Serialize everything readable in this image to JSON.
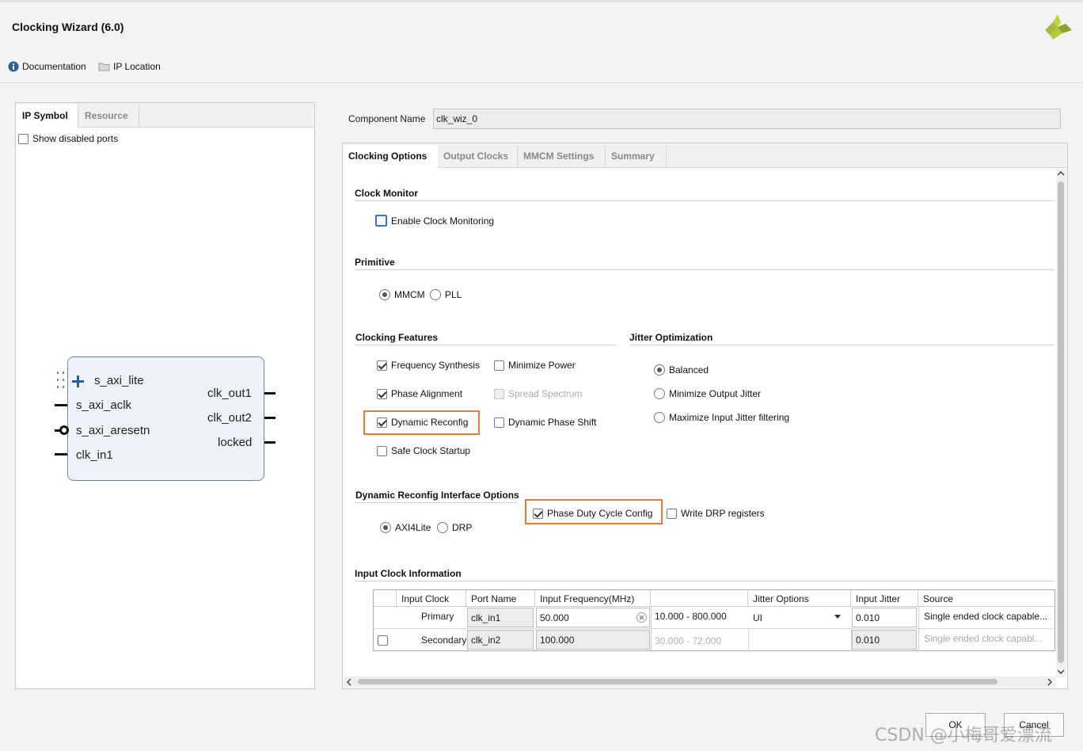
{
  "window": {
    "title": "Clocking Wizard (6.0)"
  },
  "header_links": {
    "documentation": "Documentation",
    "ip_location": "IP Location"
  },
  "left_panel": {
    "tabs": [
      "IP Symbol",
      "Resource"
    ],
    "show_disabled_ports": "Show disabled ports",
    "symbol": {
      "inputs": [
        "s_axi_lite",
        "s_axi_aclk",
        "s_axi_aresetn",
        "clk_in1"
      ],
      "outputs": [
        "clk_out1",
        "clk_out2",
        "locked"
      ]
    }
  },
  "component": {
    "label": "Component Name",
    "value": "clk_wiz_0"
  },
  "tabs": [
    "Clocking Options",
    "Output Clocks",
    "MMCM Settings",
    "Summary"
  ],
  "clock_monitor": {
    "title": "Clock Monitor",
    "enable": "Enable Clock Monitoring"
  },
  "primitive": {
    "title": "Primitive",
    "mmcm": "MMCM",
    "pll": "PLL"
  },
  "clocking_features": {
    "title": "Clocking Features",
    "frequency_synthesis": "Frequency Synthesis",
    "minimize_power": "Minimize Power",
    "phase_alignment": "Phase Alignment",
    "spread_spectrum": "Spread Spectrum",
    "dynamic_reconfig": "Dynamic Reconfig",
    "dynamic_phase_shift": "Dynamic Phase Shift",
    "safe_clock_startup": "Safe Clock Startup"
  },
  "jitter_optimization": {
    "title": "Jitter Optimization",
    "balanced": "Balanced",
    "minimize_output_jitter": "Minimize Output Jitter",
    "maximize_input_jitter": "Maximize Input Jitter filtering"
  },
  "drp_options": {
    "title": "Dynamic Reconfig Interface Options",
    "axi4lite": "AXI4Lite",
    "drp": "DRP",
    "phase_duty": "Phase Duty Cycle Config",
    "write_drp": "Write DRP registers"
  },
  "input_clock": {
    "title": "Input Clock Information",
    "headers": [
      "Input Clock",
      "Port Name",
      "Input Frequency(MHz)",
      "",
      "Jitter Options",
      "Input Jitter",
      "Source"
    ],
    "rows": [
      {
        "clock": "Primary",
        "port": "clk_in1",
        "freq": "50.000",
        "range": "10.000 - 800.000",
        "jitter_opt": "UI",
        "jitter": "0.010",
        "source": "Single ended clock capable..."
      },
      {
        "clock": "Secondary",
        "port": "clk_in2",
        "freq": "100.000",
        "range": "30.000 - 72.000",
        "jitter_opt": "",
        "jitter": "0.010",
        "source": "Single ended clock capabl..."
      }
    ]
  },
  "buttons": {
    "ok": "OK",
    "cancel": "Cancel"
  },
  "watermark": "CSDN @小梅哥爱漂流",
  "colors": {
    "highlight": "#ec7a30",
    "symbol_fill": "#eef3fa",
    "info_icon": "#2f5d95"
  }
}
